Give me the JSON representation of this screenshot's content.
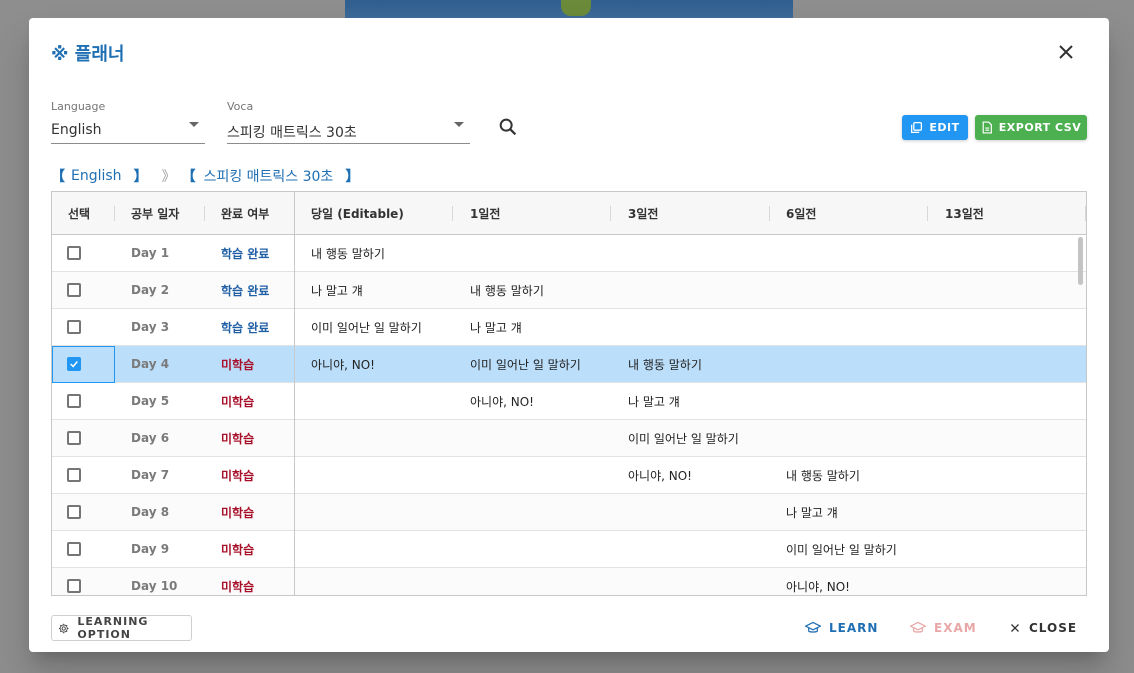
{
  "dialog": {
    "title": "※ 플래너"
  },
  "filters": {
    "language_label": "Language",
    "language_value": "English",
    "voca_label": "Voca",
    "voca_value": "스피킹 매트릭스 30초"
  },
  "toolbar": {
    "edit_label": "EDIT",
    "export_label": "EXPORT CSV"
  },
  "breadcrumb": {
    "open1": "【",
    "language": "English",
    "close1": "】",
    "separator": "》",
    "open2": "【",
    "voca": "스피킹 매트릭스 30초",
    "close2": "】"
  },
  "grid": {
    "columns": [
      "선택",
      "공부 일자",
      "완료 여부",
      "당일 (Editable)",
      "1일전",
      "3일전",
      "6일전",
      "13일전"
    ],
    "rows": [
      {
        "checked": false,
        "day": "Day 1",
        "status": "학습 완료",
        "done": true,
        "today": "내 행동 말하기",
        "d1": "",
        "d3": "",
        "d6": "",
        "d13": ""
      },
      {
        "checked": false,
        "day": "Day 2",
        "status": "학습 완료",
        "done": true,
        "today": "나 말고 걔",
        "d1": "내 행동 말하기",
        "d3": "",
        "d6": "",
        "d13": ""
      },
      {
        "checked": false,
        "day": "Day 3",
        "status": "학습 완료",
        "done": true,
        "today": "이미 일어난 일 말하기",
        "d1": "나 말고 걔",
        "d3": "",
        "d6": "",
        "d13": ""
      },
      {
        "checked": true,
        "day": "Day 4",
        "status": "미학습",
        "done": false,
        "today": "아니야, NO!",
        "d1": "이미 일어난 일 말하기",
        "d3": "내 행동 말하기",
        "d6": "",
        "d13": ""
      },
      {
        "checked": false,
        "day": "Day 5",
        "status": "미학습",
        "done": false,
        "today": "",
        "d1": "아니야, NO!",
        "d3": "나 말고 걔",
        "d6": "",
        "d13": ""
      },
      {
        "checked": false,
        "day": "Day 6",
        "status": "미학습",
        "done": false,
        "today": "",
        "d1": "",
        "d3": "이미 일어난 일 말하기",
        "d6": "",
        "d13": ""
      },
      {
        "checked": false,
        "day": "Day 7",
        "status": "미학습",
        "done": false,
        "today": "",
        "d1": "",
        "d3": "아니야, NO!",
        "d6": "내 행동 말하기",
        "d13": ""
      },
      {
        "checked": false,
        "day": "Day 8",
        "status": "미학습",
        "done": false,
        "today": "",
        "d1": "",
        "d3": "",
        "d6": "나 말고 걔",
        "d13": ""
      },
      {
        "checked": false,
        "day": "Day 9",
        "status": "미학습",
        "done": false,
        "today": "",
        "d1": "",
        "d3": "",
        "d6": "이미 일어난 일 말하기",
        "d13": ""
      },
      {
        "checked": false,
        "day": "Day 10",
        "status": "미학습",
        "done": false,
        "today": "",
        "d1": "",
        "d3": "",
        "d6": "아니야, NO!",
        "d13": ""
      }
    ]
  },
  "footer": {
    "option_label": "LEARNING OPTION",
    "learn_label": "LEARN",
    "exam_label": "EXAM",
    "close_label": "CLOSE"
  },
  "colors": {
    "accent": "#1f6fb3",
    "edit": "#2196f3",
    "export": "#4caf50",
    "done": "#1f5fa6",
    "todo": "#a8102a",
    "selected_row": "#bbdefb"
  },
  "icons": {
    "close": "close-icon",
    "search": "search-icon",
    "edit": "copy-edit-icon",
    "export": "file-icon",
    "option": "gear-icon",
    "learn": "school-icon",
    "exam": "school-icon",
    "close_footer": "close-icon",
    "checkbox_checked": "check-icon"
  }
}
